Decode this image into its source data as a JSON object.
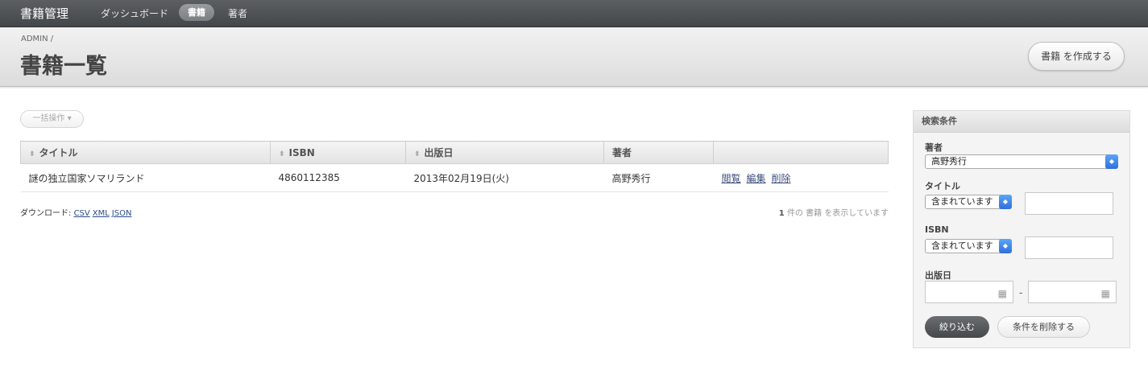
{
  "nav": {
    "brand": "書籍管理",
    "items": [
      "ダッシュボード",
      "書籍",
      "著者"
    ],
    "active": "書籍"
  },
  "header": {
    "breadcrumb": "ADMIN /",
    "title": "書籍一覧",
    "create_button": "書籍 を作成する"
  },
  "toolbar": {
    "batch_label": "一括操作 ▾"
  },
  "table": {
    "columns": [
      "タイトル",
      "ISBN",
      "出版日",
      "著者",
      ""
    ],
    "rows": [
      {
        "title": "謎の独立国家ソマリランド",
        "isbn": "4860112385",
        "published": "2013年02月19日(火)",
        "author": "高野秀行",
        "actions": [
          "閲覧",
          "編集",
          "削除"
        ]
      }
    ]
  },
  "footer": {
    "download_label": "ダウンロード:",
    "formats": [
      "CSV",
      "XML",
      "JSON"
    ],
    "count_number": "1",
    "count_text": "件の 書籍 を表示しています"
  },
  "sidebar": {
    "heading": "検索条件",
    "author_label": "著者",
    "author_value": "高野秀行",
    "title_label": "タイトル",
    "title_operator": "含まれています",
    "isbn_label": "ISBN",
    "isbn_operator": "含まれています",
    "date_label": "出版日",
    "date_separator": "-",
    "filter_button": "絞り込む",
    "clear_button": "条件を削除する"
  },
  "colors": {
    "topbar": "#4e5154",
    "link": "#2b4a8a",
    "primary_button": "#55585b",
    "select_arrow": "#3d82e8"
  }
}
